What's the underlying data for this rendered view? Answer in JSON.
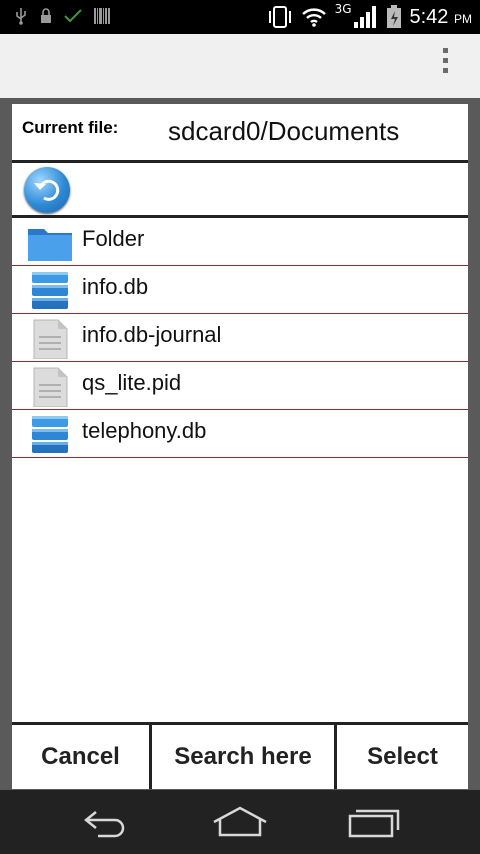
{
  "status_bar": {
    "time": "5:42",
    "ampm": "PM",
    "network": "3G",
    "icons": [
      "usb-icon",
      "lock-icon",
      "check-icon",
      "barcode-icon",
      "vibrate-icon",
      "wifi-icon",
      "signal-icon",
      "battery-icon"
    ]
  },
  "dialog": {
    "current_file_label": "Current file:",
    "current_path": "sdcard0/Documents",
    "items": [
      {
        "name": "Folder",
        "icon": "folder-icon"
      },
      {
        "name": "info.db",
        "icon": "database-icon"
      },
      {
        "name": "info.db-journal",
        "icon": "file-icon"
      },
      {
        "name": "qs_lite.pid",
        "icon": "file-icon"
      },
      {
        "name": "telephony.db",
        "icon": "database-icon"
      }
    ],
    "buttons": {
      "cancel": "Cancel",
      "search_here": "Search here",
      "select": "Select"
    }
  },
  "colors": {
    "divider": "#9b2b2b",
    "accent_blue": "#2d8ad6"
  }
}
